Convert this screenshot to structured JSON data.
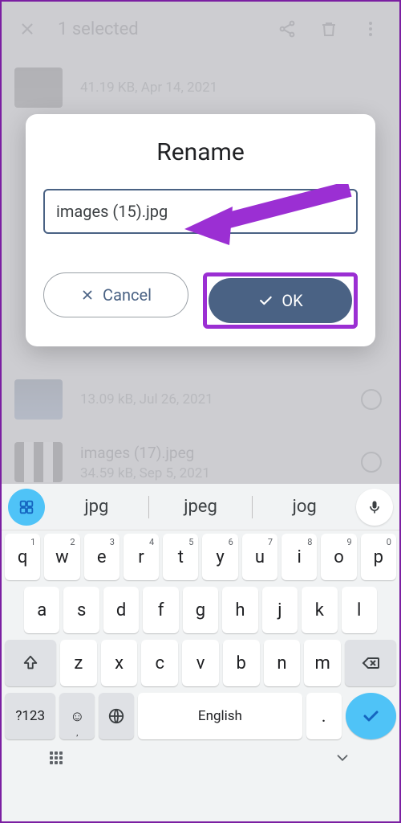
{
  "topbar": {
    "title": "1 selected"
  },
  "background_list": [
    {
      "name": "",
      "meta": "41.19 KB, Apr 14, 2021"
    },
    {
      "name": "",
      "meta": "13.09 kB, Jul 26, 2021"
    },
    {
      "name": "images (17).jpeg",
      "meta": "34.59 kB, Sep 5, 2021"
    }
  ],
  "modal": {
    "title": "Rename",
    "input_value": "images (15).jpg",
    "cancel_label": "Cancel",
    "ok_label": "OK"
  },
  "keyboard": {
    "suggestions": [
      "jpg",
      "jpeg",
      "jog"
    ],
    "row1": [
      {
        "k": "q",
        "n": "1"
      },
      {
        "k": "w",
        "n": "2"
      },
      {
        "k": "e",
        "n": "3"
      },
      {
        "k": "r",
        "n": "4"
      },
      {
        "k": "t",
        "n": "5"
      },
      {
        "k": "y",
        "n": "6"
      },
      {
        "k": "u",
        "n": "7"
      },
      {
        "k": "i",
        "n": "8"
      },
      {
        "k": "o",
        "n": "9"
      },
      {
        "k": "p",
        "n": "0"
      }
    ],
    "row2": [
      "a",
      "s",
      "d",
      "f",
      "g",
      "h",
      "j",
      "k",
      "l"
    ],
    "row3": [
      "z",
      "x",
      "c",
      "v",
      "b",
      "n",
      "m"
    ],
    "mode_key": "?123",
    "space_label": "English",
    "dot_key": "."
  },
  "annotation": {
    "ok_highlight_color": "#9b2fd3",
    "arrow_color": "#9b2fd3"
  }
}
